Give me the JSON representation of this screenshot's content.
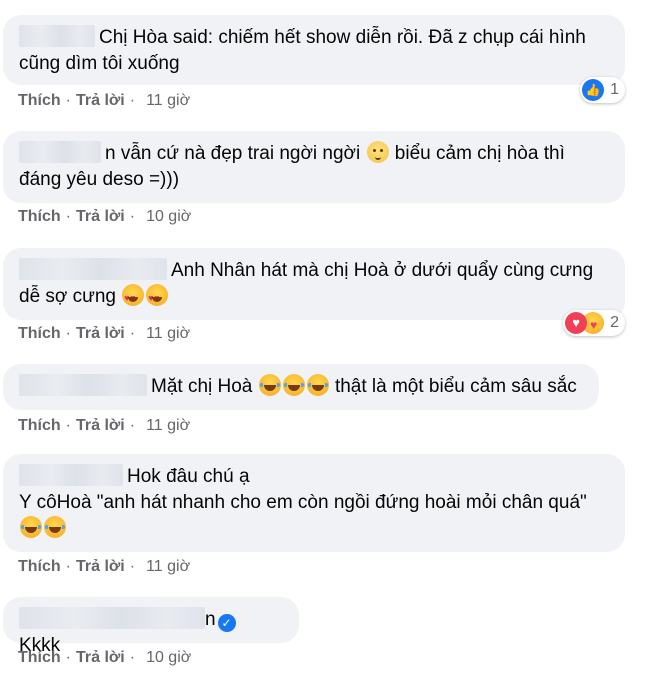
{
  "actions": {
    "like": "Thích",
    "reply": "Trả lời",
    "dot": "·"
  },
  "comments": [
    {
      "text_line1": "Chị Hòa said: chiếm hết show diễn rồi. Đã z chụp cái hình",
      "text_line2": "cũng dìm tôi xuống",
      "time": "11 giờ",
      "reaction_count": "1",
      "reaction_icon": "like-icon"
    },
    {
      "text_part1": "n vẫn cứ nà đẹp trai ngời ngời",
      "text_part2": "biểu cảm chị hòa thì",
      "text_line2": "đáng yêu deso =)))",
      "time": "10 giờ"
    },
    {
      "text_line1": "Anh Nhân hát mà chị Hoà ở dưới quẩy cùng cưng",
      "text_line2": "dễ sợ cưng",
      "time": "11 giờ",
      "reaction_count": "2",
      "reaction_icon": "love-care-icon"
    },
    {
      "name_fragment": "Mặt chị Hoà",
      "text_part2": "thật là một biểu cảm sâu sắc",
      "time": "11 giờ"
    },
    {
      "text_line1": "Hok đâu chú ạ",
      "text_line2": "Y côHoà \"anh hát nhanh cho em còn ngồi đứng hoài mỏi chân quá\"",
      "time": "11 giờ"
    },
    {
      "name_suffix": "n",
      "text": "Kkkk",
      "time": "10 giờ"
    }
  ],
  "colors": {
    "bubble": "#f0f2f5",
    "meta": "#65676b",
    "accent": "#1877f2"
  }
}
